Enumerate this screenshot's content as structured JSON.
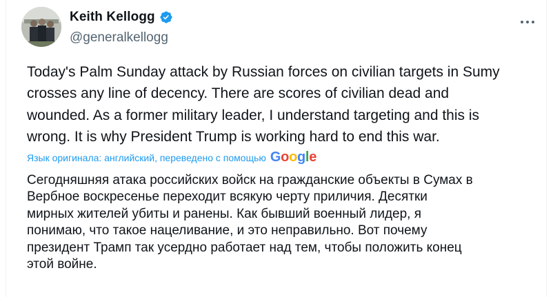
{
  "author": {
    "name": "Keith Kellogg",
    "handle": "@generalkellogg"
  },
  "tweet": {
    "text": "Today's Palm Sunday attack by Russian forces on civilian targets in Sumy\ncrosses any line of decency.  There are scores of civilian dead and\nwounded. As a former military leader, I understand targeting and this is\nwrong. It is why President Trump is working hard to end this war."
  },
  "translation": {
    "label": "Язык оригинала: английский, переведено с помощью",
    "provider": "Google",
    "text": "Сегодняшняя атака российских войск на гражданские объекты в Сумах в\nВербное воскресенье переходит всякую черту приличия. Десятки\nмирных жителей убиты и ранены. Как бывший военный лидер, я\nпонимаю, что такое нацеливание, и это неправильно. Вот почему\nпрезидент Трамп так усердно работает над тем, чтобы положить конец\nэтой войне."
  },
  "colors": {
    "verified": "#1d9bf0",
    "link": "#1d9bf0",
    "secondary_text": "#536471"
  },
  "icons": {
    "verified": "verified-badge-icon",
    "more": "more-options-icon"
  }
}
